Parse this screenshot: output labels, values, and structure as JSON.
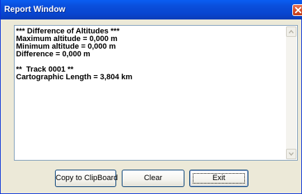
{
  "window": {
    "title": "Report Window",
    "close_icon": "close-icon",
    "title_bar_color": "#0a4fdc",
    "close_button_color": "#d8502a",
    "face_color": "#ece9d8"
  },
  "report": {
    "lines": [
      "*** Difference of Altitudes ***",
      "Maximum altitude = 0,000 m",
      "Minimum altitude = 0,000 m",
      "Difference = 0,000 m",
      "",
      "**  Track 0001 **",
      "Cartographic Length = 3,804 km"
    ],
    "scroll_up_icon": "arrow-up-icon",
    "scroll_down_icon": "arrow-down-icon"
  },
  "buttons": {
    "copy_label": "Copy to ClipBoard",
    "clear_label": "Clear",
    "exit_label": "Exit"
  }
}
